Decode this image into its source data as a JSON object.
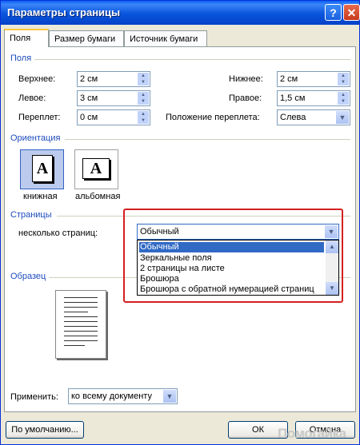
{
  "window": {
    "title": "Параметры страницы"
  },
  "tabs": [
    "Поля",
    "Размер бумаги",
    "Источник бумаги"
  ],
  "margins": {
    "section": "Поля",
    "top_label": "Верхнее:",
    "top_value": "2 см",
    "bottom_label": "Нижнее:",
    "bottom_value": "2 см",
    "left_label": "Левое:",
    "left_value": "3 см",
    "right_label": "Правое:",
    "right_value": "1,5 см",
    "gutter_label": "Переплет:",
    "gutter_value": "0 см",
    "gutter_pos_label": "Положение переплета:",
    "gutter_pos_value": "Слева"
  },
  "orientation": {
    "section": "Ориентация",
    "portrait": "книжная",
    "landscape": "альбомная",
    "glyph": "A"
  },
  "pages": {
    "section": "Страницы",
    "multiple_label": "несколько страниц:",
    "multiple_value": "Обычный",
    "options": [
      "Обычный",
      "Зеркальные поля",
      "2 страницы на листе",
      "Брошюра",
      "Брошюра с обратной нумерацией страниц"
    ]
  },
  "preview": {
    "section": "Образец",
    "apply_label": "Применить:",
    "apply_value": "ко всему документу"
  },
  "buttons": {
    "default": "По умолчанию...",
    "ok": "ОК",
    "cancel": "Отмена"
  },
  "watermark": "Помогайка",
  "colors": {
    "highlight": "#316ac5",
    "callout": "#d42020",
    "section_text": "#1d4cbd"
  }
}
